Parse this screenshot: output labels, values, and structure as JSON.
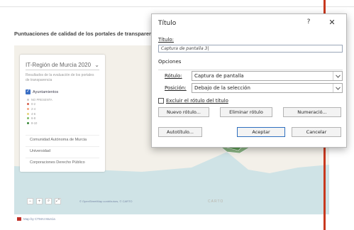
{
  "document": {
    "title": "Puntuaciones de calidad de los portales de transparencia"
  },
  "map_panel": {
    "region_select": "IT-Región de Murcia 2020",
    "description": "Resultados de la evaluación de los portales de transparencia",
    "checkbox_label": "Ayuntamientos",
    "legend": [
      {
        "label": "NO PRESENTA",
        "color": "#c9c9c9"
      },
      {
        "label": "0-2",
        "color": "#d6604d"
      },
      {
        "label": "2-4",
        "color": "#f4a582"
      },
      {
        "label": "4-6",
        "color": "#e6d27a"
      },
      {
        "label": "6-8",
        "color": "#7fbc6a"
      },
      {
        "label": "8-10",
        "color": "#3c8a3c"
      }
    ],
    "options": [
      "Comunidad Autónoma de Murcia",
      "Universidad",
      "Corporaciones Derecho Público"
    ]
  },
  "map_controls": {
    "zoom_in": "+",
    "zoom_out": "−",
    "search": "⌕",
    "fullscreen": "⤢"
  },
  "attribution": "© OpenStreetMap contributors, © CARTO",
  "carto_label": "CARTO",
  "footer_text": "Map by CTMAI Murcia",
  "dialog": {
    "title": "Título",
    "help": "?",
    "close": "✕",
    "caption_label": "Título:",
    "caption_value": "Captura de pantalla 3|",
    "options_label": "Opciones",
    "rotulo_label": "Rótulo:",
    "rotulo_value": "Captura de pantalla",
    "posicion_label": "Posición:",
    "posicion_value": "Debajo de la selección",
    "exclude_label": "Excluir el rótulo del título",
    "buttons": {
      "new_label": "Nuevo rótulo...",
      "delete_label": "Eliminar rótulo",
      "numbering": "Numeració...",
      "autocaption": "Autotítulo...",
      "ok": "Aceptar",
      "cancel": "Cancelar"
    }
  }
}
